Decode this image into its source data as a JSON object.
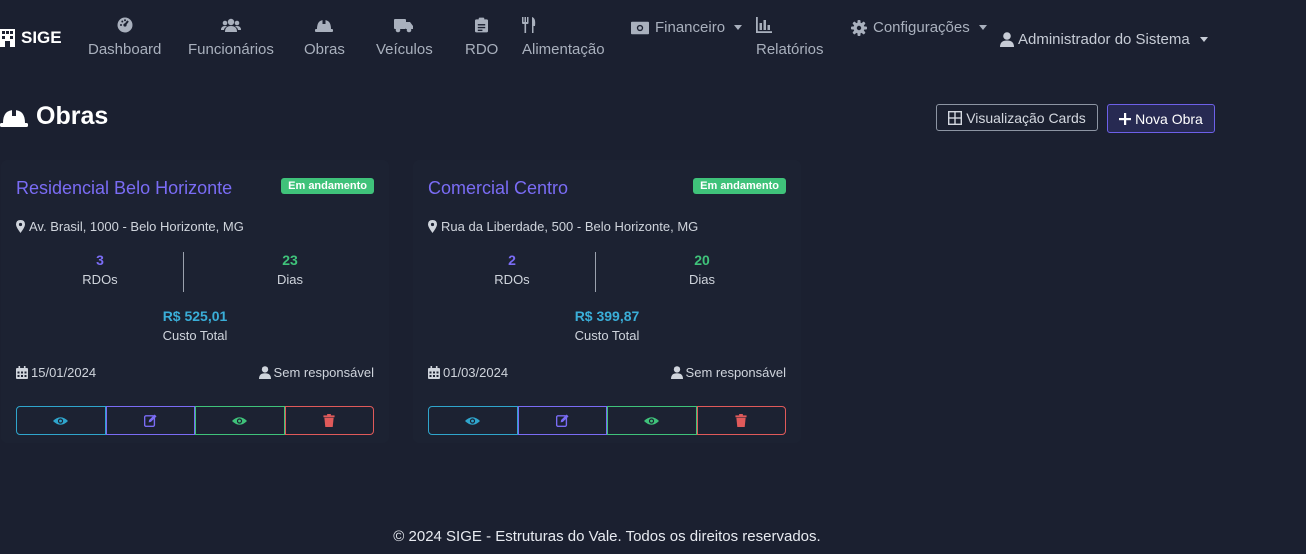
{
  "navbar": {
    "brand": "SIGE",
    "items": [
      {
        "label": "Dashboard",
        "icon": "gauge-icon"
      },
      {
        "label": "Funcionários",
        "icon": "users-icon"
      },
      {
        "label": "Obras",
        "icon": "hardhat-icon"
      },
      {
        "label": "Veículos",
        "icon": "truck-icon"
      },
      {
        "label": "RDO",
        "icon": "clipboard-icon"
      },
      {
        "label": "Alimentação",
        "icon": "utensils-icon"
      }
    ],
    "financeiro": "Financeiro",
    "relatorios": "Relatórios",
    "configuracoes": "Configurações",
    "user": "Administrador do Sistema"
  },
  "page": {
    "title": "Obras",
    "view_button": "Visualização Cards",
    "new_button": "Nova Obra"
  },
  "obras": [
    {
      "name": "Residencial Belo Horizonte",
      "status": "Em andamento",
      "address": "Av. Brasil, 1000 - Belo Horizonte, MG",
      "rdos": "3",
      "rdos_label": "RDOs",
      "dias": "23",
      "dias_label": "Dias",
      "custo": "R$ 525,01",
      "custo_label": "Custo Total",
      "data": "15/01/2024",
      "responsavel": "Sem responsável"
    },
    {
      "name": "Comercial Centro",
      "status": "Em andamento",
      "address": "Rua da Liberdade, 500 - Belo Horizonte, MG",
      "rdos": "2",
      "rdos_label": "RDOs",
      "dias": "20",
      "dias_label": "Dias",
      "custo": "R$ 399,87",
      "custo_label": "Custo Total",
      "data": "01/03/2024",
      "responsavel": "Sem responsável"
    }
  ],
  "colors": {
    "background": "#1b2030",
    "primary": "#7a6cf5",
    "info": "#2fa5cc",
    "success": "#3fc27a",
    "danger": "#e05a5a"
  },
  "footer": "© 2024 SIGE - Estruturas do Vale. Todos os direitos reservados."
}
